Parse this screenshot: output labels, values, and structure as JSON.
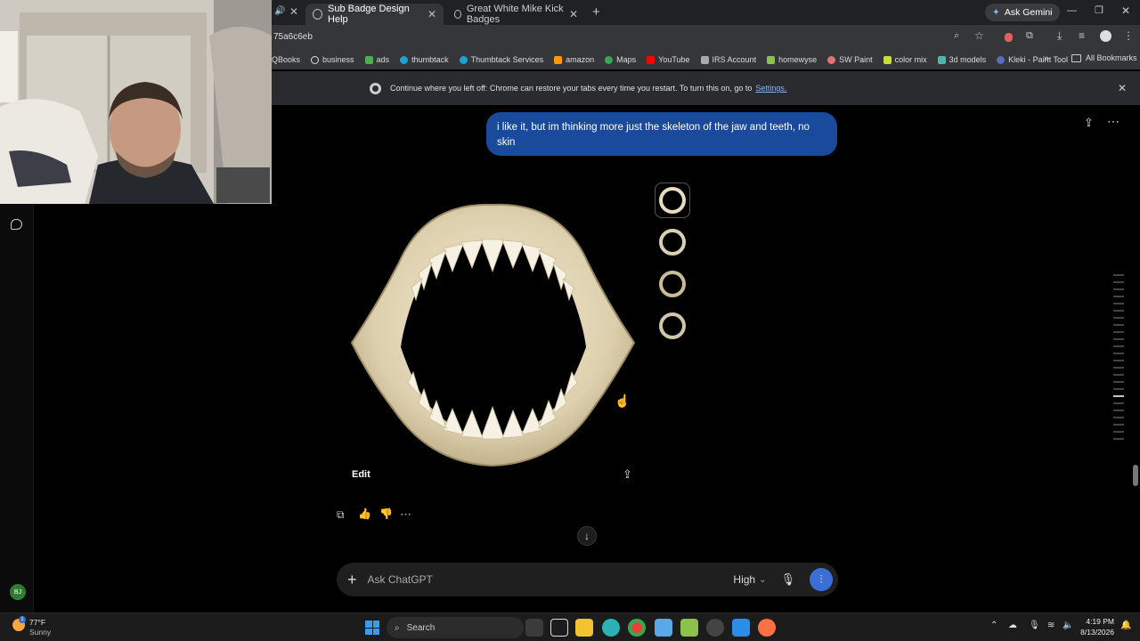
{
  "browser": {
    "tabs": [
      {
        "label": "Sub Badge Design Help",
        "active": true
      },
      {
        "label": "Great White Mike Kick Badges",
        "active": false
      }
    ],
    "ask_gemini": "Ask Gemini",
    "url_fragment": "75a6c6eb",
    "bookmarks": [
      "QBooks",
      "business",
      "ads",
      "thumbtack",
      "Thumbtack Services",
      "amazon",
      "Maps",
      "YouTube",
      "IRS Account",
      "homewyse",
      "SW Paint",
      "color mix",
      "3d models",
      "Kleki - Paint Tool"
    ],
    "bookmarks_overflow": "»",
    "all_bookmarks": "All Bookmarks",
    "restore_bar": {
      "text": "Continue where you left off: Chrome can restore your tabs every time you restart. To turn this on, go to",
      "link": "Settings."
    }
  },
  "chat": {
    "user_message": "i like it, but im thinking more just the skeleton of the jaw and teeth, no skin",
    "image_actions": {
      "edit_label": "Edit"
    },
    "composer": {
      "plus": "+",
      "placeholder": "Ask ChatGPT",
      "model": "High"
    }
  },
  "sidebar": {
    "avatar_initials": "BJ"
  },
  "taskbar": {
    "weather_temp": "77°F",
    "weather_desc": "Sunny",
    "search_label": "Search",
    "time": "4:19 PM",
    "date": "8/13/2026"
  },
  "colors": {
    "bubble": "#1a4a9c",
    "accent_voice": "#3b6fd6",
    "bone": "#e7dcc0"
  }
}
